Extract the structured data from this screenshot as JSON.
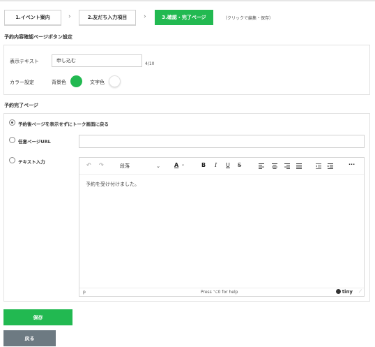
{
  "steps": [
    {
      "label": "1.イベント案内"
    },
    {
      "label": "2.友だち入力項目"
    },
    {
      "label": "3.確認・完了ページ"
    }
  ],
  "step_chevron": "›",
  "step_hint": "（クリックで編集・保存）",
  "confirm_section": {
    "title": "予約内容確認ページボタン設定",
    "display_text_label": "表示テキスト",
    "display_text_value": "申し込む",
    "display_text_counter": "4/10",
    "color_label": "カラー設定",
    "bg_color_label": "背景色",
    "bg_color": "#22b951",
    "text_color_label": "文字色",
    "text_color": "#ffffff"
  },
  "complete_section": {
    "title": "予約完了ページ",
    "options": [
      {
        "label": "予約後ページを表示せずにトーク画面に戻る",
        "checked": true
      },
      {
        "label": "任意ページURL",
        "checked": false
      },
      {
        "label": "テキスト入力",
        "checked": false
      }
    ],
    "url_value": ""
  },
  "editor": {
    "undo_icon": "↶",
    "redo_icon": "↷",
    "block_format": "段落",
    "block_chevron": "⌄",
    "text_color_icon": "A",
    "bold": "B",
    "italic": "I",
    "underline": "U",
    "strikethrough": "S",
    "more_icon": "···",
    "content": "予約を受け付けました。",
    "status_path": "p",
    "status_help": "Press ⌥0 for help",
    "brand": "tiny",
    "resize_icon": "⟋"
  },
  "buttons": {
    "save": "保存",
    "back": "戻る"
  },
  "colors": {
    "accent": "#22b951",
    "back_button": "#6d7a82"
  }
}
